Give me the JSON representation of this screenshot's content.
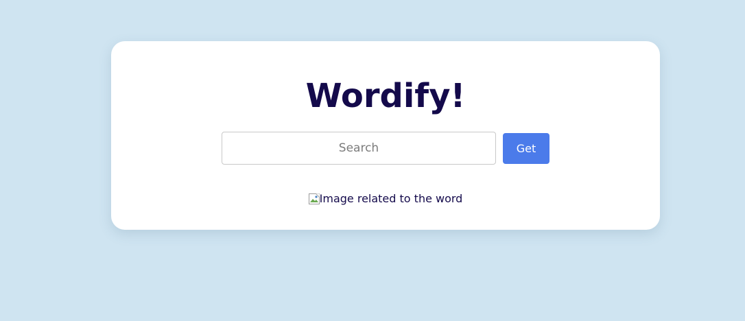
{
  "app": {
    "title": "Wordify!"
  },
  "search": {
    "placeholder": "Search",
    "value": "",
    "button_label": "Get"
  },
  "result_image": {
    "alt_text": "Image related to the word",
    "icon": "broken-image-icon"
  },
  "colors": {
    "background": "#cfe4f1",
    "card": "#ffffff",
    "title": "#140a4b",
    "button": "#4b7bea",
    "button_text": "#ffffff"
  }
}
